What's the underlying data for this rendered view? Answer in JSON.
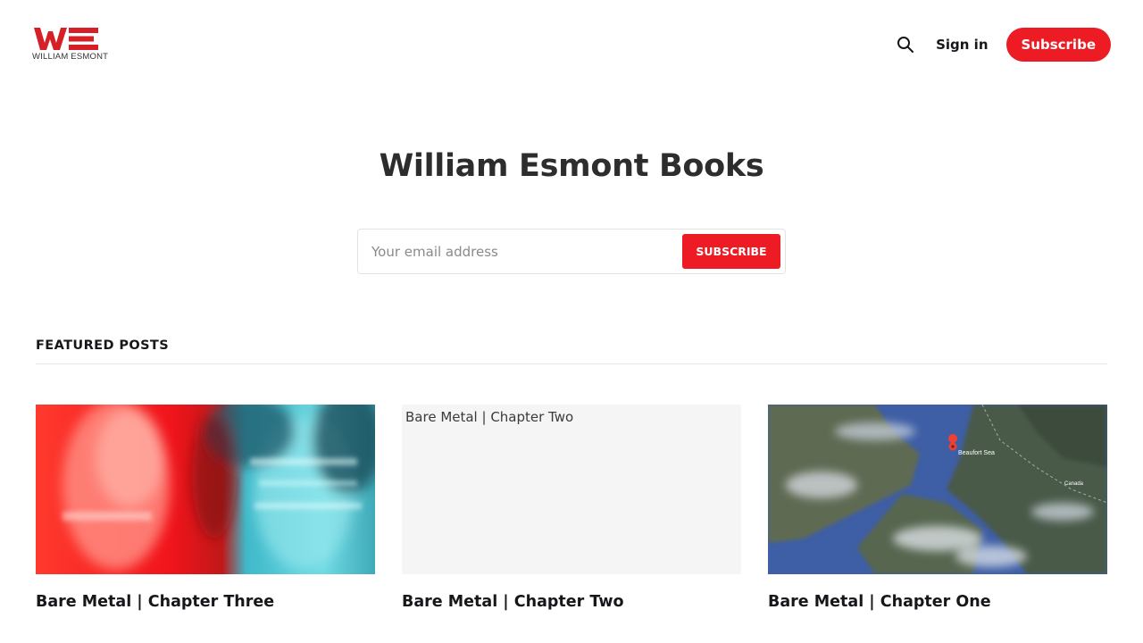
{
  "header": {
    "logo_letters": "WE",
    "logo_text": "WILLIAM ESMONT",
    "search_icon": "search-icon",
    "signin_label": "Sign in",
    "subscribe_label": "Subscribe",
    "brand_color": "#ed1c24"
  },
  "hero": {
    "title": "William Esmont Books",
    "email_placeholder": "Your email address",
    "submit_label": "SUBSCRIBE"
  },
  "featured": {
    "heading": "FEATURED POSTS",
    "posts": [
      {
        "title": "Bare Metal | Chapter Three"
      },
      {
        "title": "Bare Metal | Chapter Two",
        "image_alt_text": "Bare Metal | Chapter Two"
      },
      {
        "title": "Bare Metal | Chapter One",
        "map_labels": [
          "Beaufort Sea",
          "Canada"
        ]
      }
    ]
  }
}
